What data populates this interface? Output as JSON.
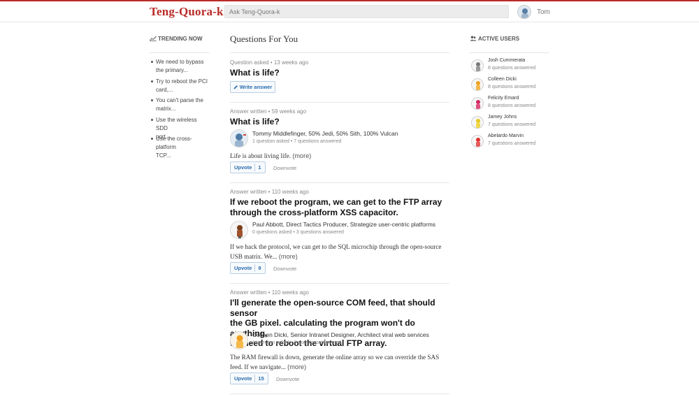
{
  "header": {
    "logo": "Teng-Quora-k",
    "search_placeholder": "Ask Teng-Quora-k",
    "user_name": "Tom"
  },
  "trending": {
    "title": "TRENDING NOW",
    "items": [
      [
        "We need to bypass",
        "the primary..."
      ],
      [
        "Try to reboot the PCI",
        "card,..."
      ],
      [
        "You can't parse the",
        "matrix..."
      ],
      [
        "Use the wireless SDD",
        "port,..."
      ],
      [
        "Use the cross-platform",
        "TCP..."
      ]
    ]
  },
  "feed": {
    "title": "Questions For You",
    "items": [
      {
        "meta": "Question asked • 13 weeks ago",
        "title": "What is life?",
        "action_label": "Write answer"
      },
      {
        "meta": "Answer written • 59 weeks ago",
        "title": "What is life?",
        "author": "Tommy Middlefinger, 50% Jedi, 50% Sith, 100% Vulcan",
        "stats": "1 question asked • 7 questions answered",
        "answer": "Life is about living life.",
        "more": "(more)",
        "upvote_label": "Upvote",
        "upvote_count": "1",
        "downvote_label": "Downvote"
      },
      {
        "meta": "Answer written • 110 weeks ago",
        "title_lines": [
          "If we reboot the program, we can get to the FTP array",
          "through the cross-platform XSS capacitor."
        ],
        "author": "Paul Abbott, Direct Tactics Producer, Strategize user-centric platforms",
        "stats": "0 questions asked • 3 questions answered",
        "answer_lines": [
          "If we hack the protocol, we can get to the SQL microchip through the open-source",
          "USB matrix. We..."
        ],
        "more": "(more)",
        "upvote_label": "Upvote",
        "upvote_count": "9",
        "downvote_label": "Downvote"
      },
      {
        "meta": "Answer written • 110 weeks ago",
        "title_lines": [
          "I'll generate the open-source COM feed, that should sensor",
          "the GB pixel. calculating the program won't do anything,",
          "we need to reboot the virtual FTP array."
        ],
        "author": "Colleen Dicki, Senior Intranet Designer, Architect viral web services",
        "stats": "1 question asked • 8 questions answered",
        "answer_lines": [
          "The RAM firewall is down, generate the online array so we can override the SAS",
          "feed. If we navigate..."
        ],
        "more": "(more)",
        "upvote_label": "Upvote",
        "upvote_count": "15",
        "downvote_label": "Downvote"
      }
    ]
  },
  "active_users": {
    "title": "ACTIVE USERS",
    "users": [
      {
        "name": "Josh Cummerata",
        "stats": "8 questions answered",
        "avatar_color": "#777777"
      },
      {
        "name": "Colleen Dicki",
        "stats": "8 questions answered",
        "avatar_color": "#f0a020"
      },
      {
        "name": "Felicity Emard",
        "stats": "8 questions answered",
        "avatar_color": "#d02860"
      },
      {
        "name": "Jamey Johns",
        "stats": "7 questions answered",
        "avatar_color": "#e8c820"
      },
      {
        "name": "Abelardo Marvin",
        "stats": "7 questions answered",
        "avatar_color": "#e03030"
      }
    ]
  },
  "colors": {
    "brand": "#b92b27",
    "link_blue": "#2b6dad"
  }
}
